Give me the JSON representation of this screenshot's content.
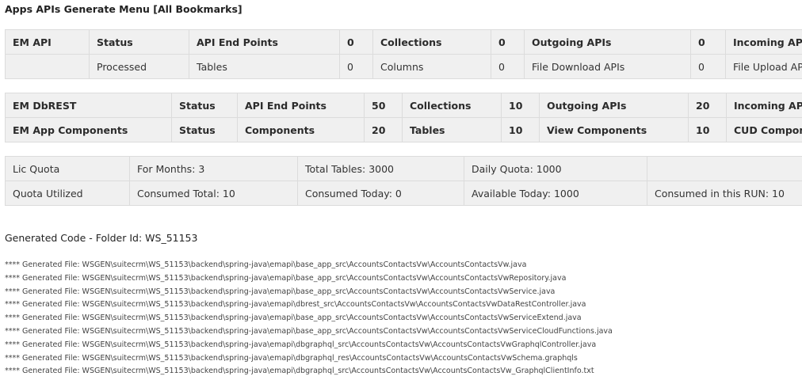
{
  "page_title": "Apps APIs Generate Menu [All Bookmarks]",
  "em_api": {
    "row1": [
      "EM API",
      "Status",
      "API End Points",
      "0",
      "Collections",
      "0",
      "Outgoing APIs",
      "0",
      "Incoming APIs"
    ],
    "row2": [
      "",
      "Processed",
      "Tables",
      "0",
      "Columns",
      "0",
      "File Download APIs",
      "0",
      "File Upload APIs"
    ]
  },
  "em_dbrest": {
    "row1": [
      "EM DbREST",
      "Status",
      "API End Points",
      "50",
      "Collections",
      "10",
      "Outgoing APIs",
      "20",
      "Incoming APIs"
    ],
    "row2": [
      "EM App Components",
      "Status",
      "Components",
      "20",
      "Tables",
      "10",
      "View Components",
      "10",
      "CUD Components"
    ]
  },
  "quota": {
    "row1": [
      "Lic Quota",
      "For Months: 3",
      "Total Tables: 3000",
      "Daily Quota: 1000",
      ""
    ],
    "row2": [
      "Quota Utilized",
      "Consumed Total: 10",
      "Consumed Today: 0",
      "Available Today: 1000",
      "Consumed in this RUN: 10"
    ]
  },
  "generated": {
    "title": "Generated Code - Folder Id: WS_51153",
    "files": [
      "**** Generated File: WSGEN\\suitecrm\\WS_51153\\backend\\spring-java\\emapi\\base_app_src\\AccountsContactsVw\\AccountsContactsVw.java",
      "**** Generated File: WSGEN\\suitecrm\\WS_51153\\backend\\spring-java\\emapi\\base_app_src\\AccountsContactsVw\\AccountsContactsVwRepository.java",
      "**** Generated File: WSGEN\\suitecrm\\WS_51153\\backend\\spring-java\\emapi\\base_app_src\\AccountsContactsVw\\AccountsContactsVwService.java",
      "**** Generated File: WSGEN\\suitecrm\\WS_51153\\backend\\spring-java\\emapi\\dbrest_src\\AccountsContactsVw\\AccountsContactsVwDataRestController.java",
      "**** Generated File: WSGEN\\suitecrm\\WS_51153\\backend\\spring-java\\emapi\\base_app_src\\AccountsContactsVw\\AccountsContactsVwServiceExtend.java",
      "**** Generated File: WSGEN\\suitecrm\\WS_51153\\backend\\spring-java\\emapi\\base_app_src\\AccountsContactsVw\\AccountsContactsVwServiceCloudFunctions.java",
      "**** Generated File: WSGEN\\suitecrm\\WS_51153\\backend\\spring-java\\emapi\\dbgraphql_src\\AccountsContactsVw\\AccountsContactsVwGraphqlController.java",
      "**** Generated File: WSGEN\\suitecrm\\WS_51153\\backend\\spring-java\\emapi\\dbgraphql_res\\AccountsContactsVw\\AccountsContactsVwSchema.graphqls",
      "**** Generated File: WSGEN\\suitecrm\\WS_51153\\backend\\spring-java\\emapi\\dbgraphql_src\\AccountsContactsVw\\AccountsContactsVw_GraphqlClientInfo.txt"
    ]
  }
}
